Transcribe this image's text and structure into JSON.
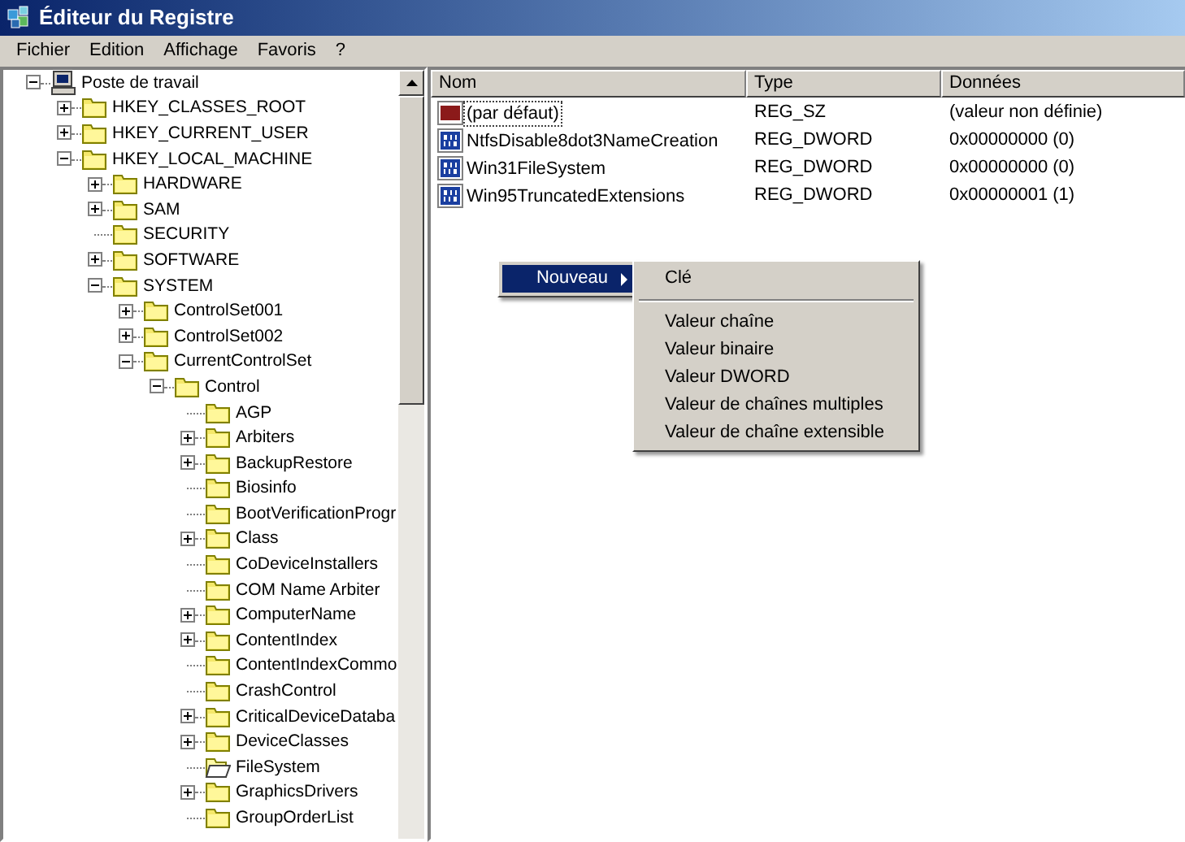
{
  "window": {
    "title": "Éditeur du Registre"
  },
  "menu_bar": [
    "Fichier",
    "Edition",
    "Affichage",
    "Favoris",
    "?"
  ],
  "tree": [
    {
      "label": "Poste de travail",
      "kind": "computer",
      "expanded": true,
      "selected": false,
      "children": [
        {
          "label": "HKEY_CLASSES_ROOT",
          "kind": "branch",
          "expanded": false,
          "selected": false
        },
        {
          "label": "HKEY_CURRENT_USER",
          "kind": "branch",
          "expanded": false,
          "selected": false
        },
        {
          "label": "HKEY_LOCAL_MACHINE",
          "kind": "branch",
          "expanded": true,
          "selected": false,
          "children": [
            {
              "label": "HARDWARE",
              "kind": "branch",
              "expanded": false,
              "selected": false
            },
            {
              "label": "SAM",
              "kind": "branch",
              "expanded": false,
              "selected": false
            },
            {
              "label": "SECURITY",
              "kind": "leaf",
              "expanded": false,
              "selected": false
            },
            {
              "label": "SOFTWARE",
              "kind": "branch",
              "expanded": false,
              "selected": false
            },
            {
              "label": "SYSTEM",
              "kind": "branch",
              "expanded": true,
              "selected": false,
              "children": [
                {
                  "label": "ControlSet001",
                  "kind": "branch",
                  "expanded": false,
                  "selected": false
                },
                {
                  "label": "ControlSet002",
                  "kind": "branch",
                  "expanded": false,
                  "selected": false
                },
                {
                  "label": "CurrentControlSet",
                  "kind": "branch",
                  "expanded": true,
                  "selected": false,
                  "children": [
                    {
                      "label": "Control",
                      "kind": "branch",
                      "expanded": true,
                      "selected": false,
                      "children": [
                        {
                          "label": "AGP",
                          "kind": "leaf",
                          "expanded": false,
                          "selected": false
                        },
                        {
                          "label": "Arbiters",
                          "kind": "branch",
                          "expanded": false,
                          "selected": false
                        },
                        {
                          "label": "BackupRestore",
                          "kind": "branch",
                          "expanded": false,
                          "selected": false
                        },
                        {
                          "label": "Biosinfo",
                          "kind": "leaf",
                          "expanded": false,
                          "selected": false
                        },
                        {
                          "label": "BootVerificationProgr",
                          "kind": "leaf",
                          "expanded": false,
                          "selected": false
                        },
                        {
                          "label": "Class",
                          "kind": "branch",
                          "expanded": false,
                          "selected": false
                        },
                        {
                          "label": "CoDeviceInstallers",
                          "kind": "leaf",
                          "expanded": false,
                          "selected": false
                        },
                        {
                          "label": "COM Name Arbiter",
                          "kind": "leaf",
                          "expanded": false,
                          "selected": false
                        },
                        {
                          "label": "ComputerName",
                          "kind": "branch",
                          "expanded": false,
                          "selected": false
                        },
                        {
                          "label": "ContentIndex",
                          "kind": "branch",
                          "expanded": false,
                          "selected": false
                        },
                        {
                          "label": "ContentIndexCommo",
                          "kind": "leaf",
                          "expanded": false,
                          "selected": false
                        },
                        {
                          "label": "CrashControl",
                          "kind": "leaf",
                          "expanded": false,
                          "selected": false
                        },
                        {
                          "label": "CriticalDeviceDataba",
                          "kind": "branch",
                          "expanded": false,
                          "selected": false
                        },
                        {
                          "label": "DeviceClasses",
                          "kind": "branch",
                          "expanded": false,
                          "selected": false
                        },
                        {
                          "label": "FileSystem",
                          "kind": "leaf",
                          "expanded": false,
                          "selected": true
                        },
                        {
                          "label": "GraphicsDrivers",
                          "kind": "branch",
                          "expanded": false,
                          "selected": false
                        },
                        {
                          "label": "GroupOrderList",
                          "kind": "leaf",
                          "expanded": false,
                          "selected": false
                        }
                      ]
                    }
                  ]
                }
              ]
            }
          ]
        }
      ]
    }
  ],
  "values": {
    "columns": [
      "Nom",
      "Type",
      "Données"
    ],
    "rows": [
      {
        "name": "(par défaut)",
        "type": "REG_SZ",
        "data": "(valeur non définie)",
        "kind": "string",
        "focused": true
      },
      {
        "name": "NtfsDisable8dot3NameCreation",
        "type": "REG_DWORD",
        "data": "0x00000000 (0)",
        "kind": "binary",
        "focused": false
      },
      {
        "name": "Win31FileSystem",
        "type": "REG_DWORD",
        "data": "0x00000000 (0)",
        "kind": "binary",
        "focused": false
      },
      {
        "name": "Win95TruncatedExtensions",
        "type": "REG_DWORD",
        "data": "0x00000001 (1)",
        "kind": "binary",
        "focused": false
      }
    ]
  },
  "context_menu": {
    "items": [
      {
        "label": "Nouveau",
        "selected": true
      }
    ]
  },
  "submenu": {
    "items": [
      {
        "kind": "item",
        "label": "Clé"
      },
      {
        "kind": "separator"
      },
      {
        "kind": "item",
        "label": "Valeur chaîne"
      },
      {
        "kind": "item",
        "label": "Valeur binaire"
      },
      {
        "kind": "item",
        "label": "Valeur DWORD"
      },
      {
        "kind": "item",
        "label": "Valeur de chaînes multiples"
      },
      {
        "kind": "item",
        "label": "Valeur de chaîne extensible"
      }
    ]
  }
}
